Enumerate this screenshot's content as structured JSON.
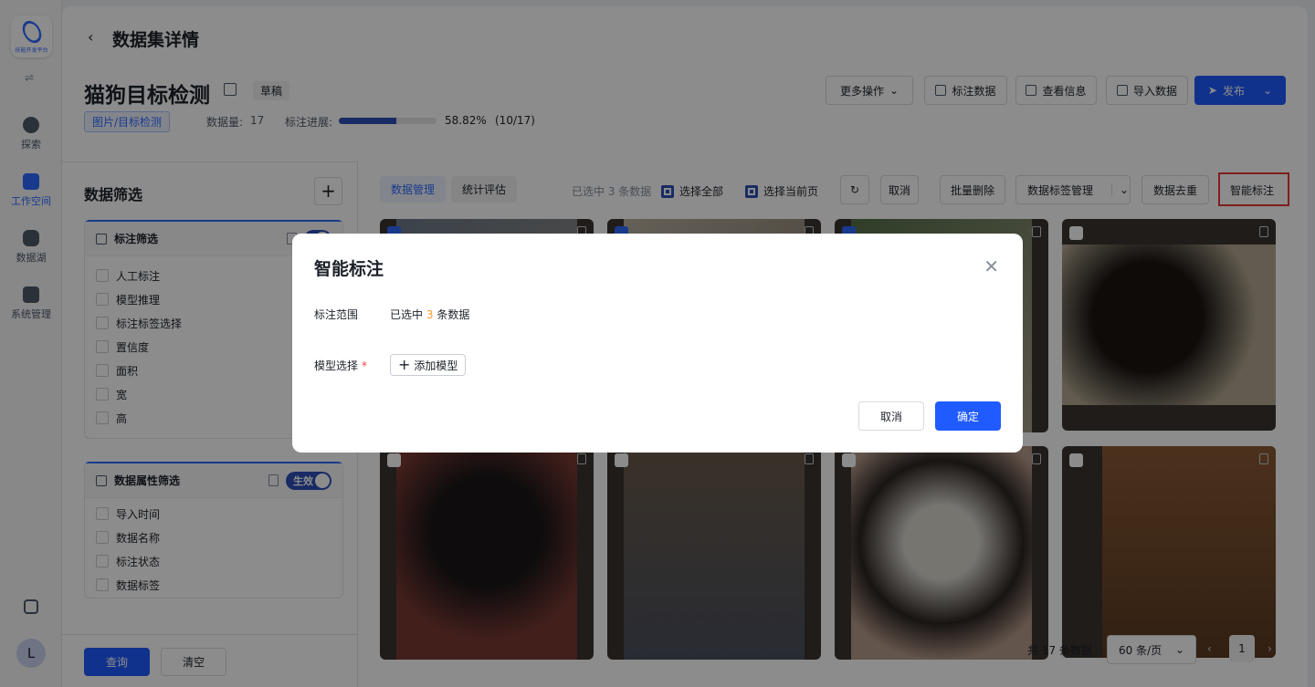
{
  "rail": {
    "logo_text": "技能开发平台",
    "items": [
      {
        "label": "探索"
      },
      {
        "label": "工作空间"
      },
      {
        "label": "数据湖"
      },
      {
        "label": "系统管理"
      }
    ],
    "avatar": "L"
  },
  "header": {
    "back_icon": "‹",
    "title": "数据集详情",
    "dataset_name": "猫狗目标检测",
    "status_tag": "草稿",
    "type_tag": "图片/目标检测",
    "count_label": "数据量:",
    "count_value": "17",
    "progress_label": "标注进展:",
    "progress_fraction": 0.5882,
    "progress_text": "58.82%",
    "progress_count": "(10/17)"
  },
  "actions": {
    "more": "更多操作",
    "annotate": "标注数据",
    "info": "查看信息",
    "import": "导入数据",
    "publish": "发布"
  },
  "filter": {
    "title": "数据筛选",
    "group1": {
      "title": "标注筛选",
      "items": [
        "人工标注",
        "模型推理",
        "标注标签选择",
        "置信度",
        "面积",
        "宽",
        "高"
      ]
    },
    "group2": {
      "title": "数据属性筛选",
      "toggle": "生效",
      "items": [
        "导入时间",
        "数据名称",
        "标注状态",
        "数据标签"
      ]
    },
    "query": "查询",
    "clear": "清空"
  },
  "toolbar": {
    "tab_manage": "数据管理",
    "tab_stats": "统计评估",
    "selected_info": "已选中 3 条数据",
    "select_all": "选择全部",
    "select_page": "选择当前页",
    "cancel": "取消",
    "batch_delete": "批量删除",
    "tag_manage": "数据标签管理",
    "dedup": "数据去重",
    "smart_annotate": "智能标注"
  },
  "pager": {
    "total": "共 17 条数据",
    "page_size": "60 条/页",
    "current": "1"
  },
  "modal": {
    "title": "智能标注",
    "scope_label": "标注范围",
    "scope_prefix": "已选中",
    "scope_count": "3",
    "scope_suffix": "条数据",
    "model_label": "模型选择",
    "add_model": "添加模型",
    "cancel": "取消",
    "confirm": "确定"
  }
}
